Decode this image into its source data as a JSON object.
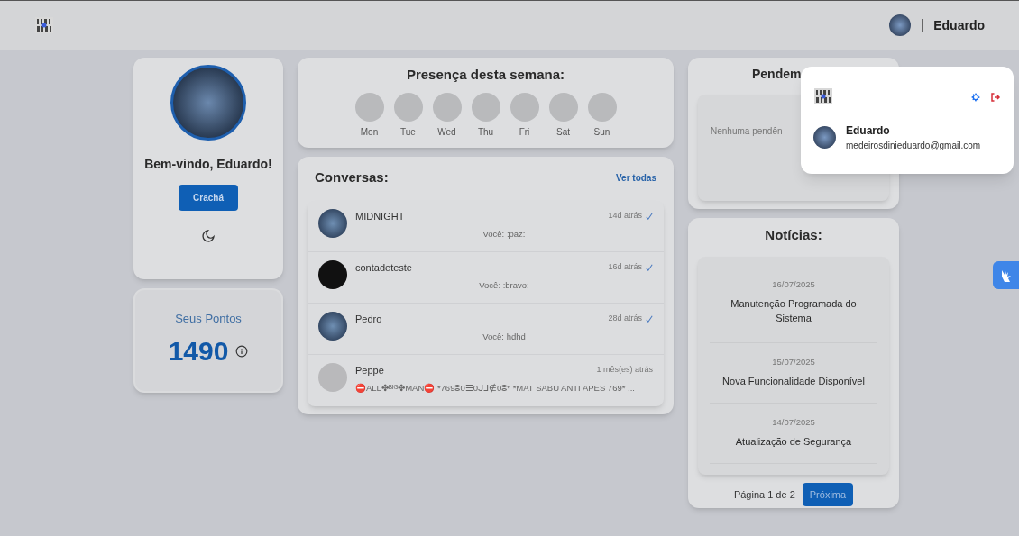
{
  "header": {
    "user_name": "Eduardo"
  },
  "profile": {
    "greeting": "Bem-vindo, Eduardo!",
    "badge_button": "Crachá"
  },
  "points": {
    "label": "Seus Pontos",
    "value": "1490"
  },
  "presence": {
    "title": "Presença desta semana:",
    "days": [
      {
        "label": "Mon",
        "present": false
      },
      {
        "label": "Tue",
        "present": false
      },
      {
        "label": "Wed",
        "present": false
      },
      {
        "label": "Thu",
        "present": false
      },
      {
        "label": "Fri",
        "present": false
      },
      {
        "label": "Sat",
        "present": false
      },
      {
        "label": "Sun",
        "present": false
      }
    ]
  },
  "conversations": {
    "title": "Conversas:",
    "see_all": "Ver todas",
    "items": [
      {
        "name": "MIDNIGHT",
        "time": "14d atrás",
        "read": true,
        "message": "Você: :paz:",
        "kind": "photo"
      },
      {
        "name": "contadeteste",
        "time": "16d atrás",
        "read": true,
        "message": "Você: :bravo:",
        "kind": "dark"
      },
      {
        "name": "Pedro",
        "time": "28d atrás",
        "read": true,
        "message": "Você: hdhd",
        "kind": "photo"
      },
      {
        "name": "Peppe",
        "time": "1 mês(es) atrás",
        "read": false,
        "message": "⛔ALL✤ᴮᴵᴳ✤MAN⛔ *769ⵓ0☰0ᒍᒧ∉0ⵓ* *MAT SABU ANTI APES 769* ...",
        "kind": "default"
      }
    ]
  },
  "pending": {
    "title": "Pendem",
    "empty": "Nenhuma pendên"
  },
  "news": {
    "title": "Notícias:",
    "items": [
      {
        "date": "16/07/2025",
        "title": "Manutenção Programada do Sistema"
      },
      {
        "date": "15/07/2025",
        "title": "Nova Funcionalidade Disponível"
      },
      {
        "date": "14/07/2025",
        "title": "Atualização de Segurança"
      }
    ],
    "page_info": "Página 1 de 2",
    "next_button": "Próxima"
  },
  "user_menu": {
    "name": "Eduardo",
    "email": "medeirosdinieduardo@gmail.com"
  }
}
